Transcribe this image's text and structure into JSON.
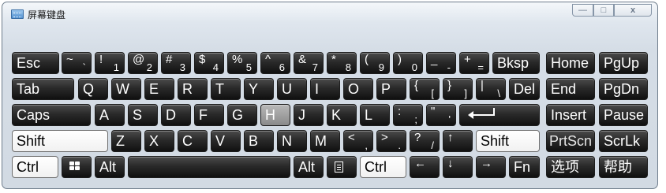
{
  "window": {
    "title": "屏幕键盘",
    "title_icon": "keyboard-icon",
    "controls": {
      "minimize": "—",
      "maximize": "□",
      "close": "x"
    }
  },
  "keyboard": {
    "row1": {
      "esc": "Esc",
      "tilde_up": "~",
      "tilde_dn": "`",
      "k1_up": "!",
      "k1_dn": "1",
      "k2_up": "@",
      "k2_dn": "2",
      "k3_up": "#",
      "k3_dn": "3",
      "k4_up": "$",
      "k4_dn": "4",
      "k5_up": "%",
      "k5_dn": "5",
      "k6_up": "^",
      "k6_dn": "6",
      "k7_up": "&",
      "k7_dn": "7",
      "k8_up": "*",
      "k8_dn": "8",
      "k9_up": "(",
      "k9_dn": "9",
      "k0_up": ")",
      "k0_dn": "0",
      "minus_up": "_",
      "minus_dn": "-",
      "equal_up": "+",
      "equal_dn": "=",
      "bksp": "Bksp",
      "home": "Home",
      "pgup": "PgUp"
    },
    "row2": {
      "tab": "Tab",
      "q": "Q",
      "w": "W",
      "e": "E",
      "r": "R",
      "t": "T",
      "y": "Y",
      "u": "U",
      "i": "I",
      "o": "O",
      "p": "P",
      "lbr_up": "{",
      "lbr_dn": "[",
      "rbr_up": "}",
      "rbr_dn": "]",
      "bs_up": "|",
      "bs_dn": "\\",
      "del": "Del",
      "end": "End",
      "pgdn": "PgDn"
    },
    "row3": {
      "caps": "Caps",
      "a": "A",
      "s": "S",
      "d": "D",
      "f": "F",
      "g": "G",
      "h": "H",
      "j": "J",
      "k": "K",
      "l": "L",
      "semi_up": ":",
      "semi_dn": ";",
      "quote_up": "\"",
      "quote_dn": "'",
      "enter_icon": "enter-arrow-icon",
      "insert": "Insert",
      "pause": "Pause"
    },
    "row4": {
      "lshift": "Shift",
      "z": "Z",
      "x": "X",
      "c": "C",
      "v": "V",
      "b": "B",
      "n": "N",
      "m": "M",
      "comma_up": "<",
      "comma_dn": ",",
      "period_up": ">",
      "period_dn": ".",
      "slash_up": "?",
      "slash_dn": "/",
      "up_arrow": "↑",
      "rshift": "Shift",
      "prtscn": "PrtScn",
      "scrlk": "ScrLk"
    },
    "row5": {
      "lctrl": "Ctrl",
      "win_icon": "windows-logo-icon",
      "lalt": "Alt",
      "ralt": "Alt",
      "menu_icon": "context-menu-icon",
      "rctrl": "Ctrl",
      "left_arrow": "←",
      "down_arrow": "↓",
      "right_arrow": "→",
      "fn": "Fn",
      "options": "选项",
      "help": "帮助"
    }
  }
}
